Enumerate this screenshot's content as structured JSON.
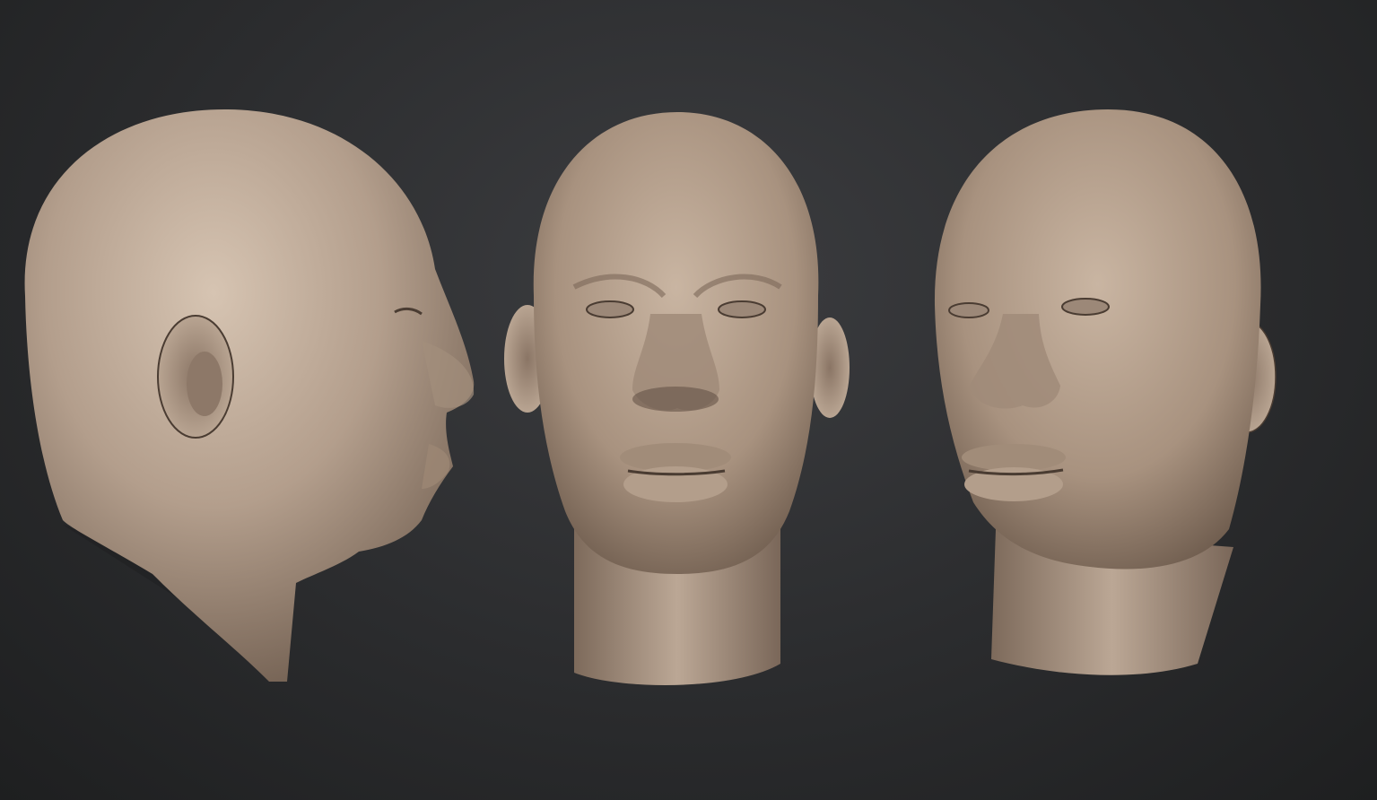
{
  "scene": {
    "background_color": "#2e2f31",
    "material_color": "#b39e8c",
    "shadow_color": "#5b4c40",
    "highlight_color": "#d2c0ae",
    "views": [
      {
        "id": "side",
        "orientation": "profile-right"
      },
      {
        "id": "front",
        "orientation": "front"
      },
      {
        "id": "three_quarter",
        "orientation": "three-quarter-left"
      }
    ]
  }
}
